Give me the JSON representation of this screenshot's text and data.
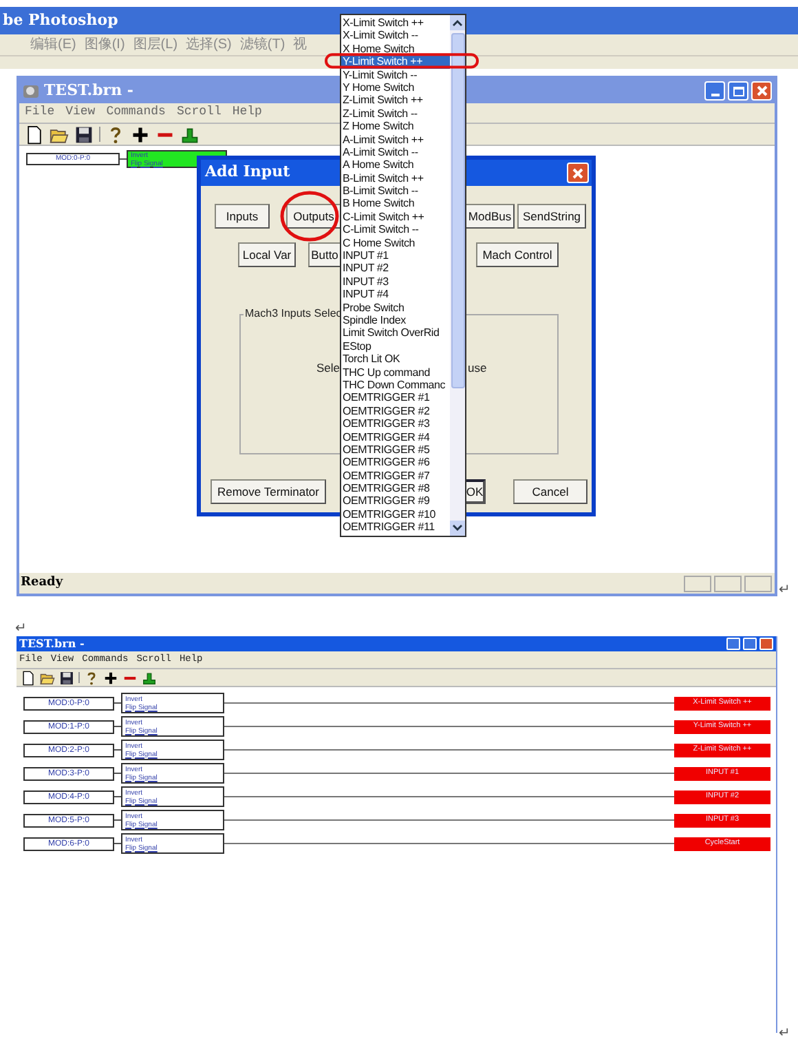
{
  "top_screenshot": {
    "background_app": {
      "title": "be Photoshop",
      "menus": [
        "编辑(E)",
        "图像(I)",
        "图层(L)",
        "选择(S)",
        "滤镜(T)",
        "视"
      ]
    },
    "window": {
      "title": "TEST.brn -",
      "menus": [
        "File",
        "View",
        "Commands",
        "Scroll",
        "Help"
      ],
      "status": "Ready"
    },
    "canvas_nodes": [
      {
        "source": "MOD:0-P:0",
        "line_1": "Invert",
        "line_2": "Flip Signal",
        "selected": true
      }
    ],
    "dialog": {
      "title": "Add Input",
      "buttons": [
        {
          "label": "Inputs"
        },
        {
          "label": "Outputs"
        },
        {
          "label": "ModBus"
        },
        {
          "label": "SendString"
        },
        {
          "label": "Local Var"
        },
        {
          "label": "Butto"
        },
        {
          "label": "Mach Control"
        }
      ],
      "group_label": "Mach3 Inputs Selec",
      "group_texts": [
        "Sele",
        "use"
      ],
      "bottom_buttons": [
        {
          "label": "Remove Terminator"
        },
        {
          "label": "OK"
        },
        {
          "label": "Cancel"
        }
      ]
    },
    "dropdown": {
      "items": [
        {
          "label": "X-Limit Switch ++",
          "selected": false
        },
        {
          "label": "X-Limit Switch --",
          "selected": false
        },
        {
          "label": "X Home Switch",
          "selected": false
        },
        {
          "label": "Y-Limit Switch ++",
          "selected": true
        },
        {
          "label": "Y-Limit Switch --",
          "selected": false
        },
        {
          "label": "Y Home Switch",
          "selected": false
        },
        {
          "label": "Z-Limit Switch ++",
          "selected": false
        },
        {
          "label": "Z-Limit Switch --",
          "selected": false
        },
        {
          "label": "Z Home Switch",
          "selected": false
        },
        {
          "label": "A-Limit Switch ++",
          "selected": false
        },
        {
          "label": "A-Limit Switch --",
          "selected": false
        },
        {
          "label": "A Home Switch",
          "selected": false
        },
        {
          "label": "B-Limit Switch ++",
          "selected": false
        },
        {
          "label": "B-Limit Switch --",
          "selected": false
        },
        {
          "label": "B Home Switch",
          "selected": false
        },
        {
          "label": "C-Limit Switch ++",
          "selected": false
        },
        {
          "label": "C-Limit Switch --",
          "selected": false
        },
        {
          "label": "C Home Switch",
          "selected": false
        },
        {
          "label": "INPUT #1",
          "selected": false
        },
        {
          "label": "INPUT #2",
          "selected": false
        },
        {
          "label": "INPUT #3",
          "selected": false
        },
        {
          "label": "INPUT #4",
          "selected": false
        },
        {
          "label": "Probe Switch",
          "selected": false
        },
        {
          "label": "Spindle Index",
          "selected": false
        },
        {
          "label": "Limit Switch OverRid",
          "selected": false
        },
        {
          "label": "EStop",
          "selected": false
        },
        {
          "label": "Torch Lit OK",
          "selected": false
        },
        {
          "label": "THC Up command",
          "selected": false
        },
        {
          "label": "THC Down Commanc",
          "selected": false
        },
        {
          "label": "OEMTRIGGER #1",
          "selected": false
        },
        {
          "label": "OEMTRIGGER #2",
          "selected": false
        },
        {
          "label": "OEMTRIGGER #3",
          "selected": false
        },
        {
          "label": "OEMTRIGGER #4",
          "selected": false
        },
        {
          "label": "OEMTRIGGER #5",
          "selected": false
        },
        {
          "label": "OEMTRIGGER #6",
          "selected": false
        },
        {
          "label": "OEMTRIGGER #7",
          "selected": false
        },
        {
          "label": "OEMTRIGGER #8",
          "selected": false
        },
        {
          "label": "OEMTRIGGER #9",
          "selected": false
        },
        {
          "label": "OEMTRIGGER #10",
          "selected": false
        },
        {
          "label": "OEMTRIGGER #11",
          "selected": false
        }
      ]
    }
  },
  "paragraph_marks": [
    "↵",
    "↵",
    "↵"
  ],
  "bottom_screenshot": {
    "window": {
      "title": "TEST.brn -",
      "menus": [
        "File",
        "View",
        "Commands",
        "Scroll",
        "Help"
      ]
    },
    "rows": [
      {
        "source": "MOD:0-P:0",
        "line_1": "Invert",
        "line_2": "Flip Signal",
        "target": "X-Limit Switch ++",
        "selected": false
      },
      {
        "source": "MOD:1-P:0",
        "line_1": "Invert",
        "line_2": "Flip Signal",
        "target": "Y-Limit Switch ++",
        "selected": false
      },
      {
        "source": "MOD:2-P:0",
        "line_1": "Invert",
        "line_2": "Flip Signal",
        "target": "Z-Limit Switch ++",
        "selected": false
      },
      {
        "source": "MOD:3-P:0",
        "line_1": "Invert",
        "line_2": "Flip Signal",
        "target": "INPUT #1",
        "selected": false
      },
      {
        "source": "MOD:4-P:0",
        "line_1": "Invert",
        "line_2": "Flip Signal",
        "target": "INPUT #2",
        "selected": false
      },
      {
        "source": "MOD:5-P:0",
        "line_1": "Invert",
        "line_2": "Flip Signal",
        "target": "INPUT #3",
        "selected": false
      },
      {
        "source": "MOD:6-P:0",
        "line_1": "Invert",
        "line_2": "Flip Signal",
        "target": "CycleStart",
        "selected": false
      }
    ]
  }
}
